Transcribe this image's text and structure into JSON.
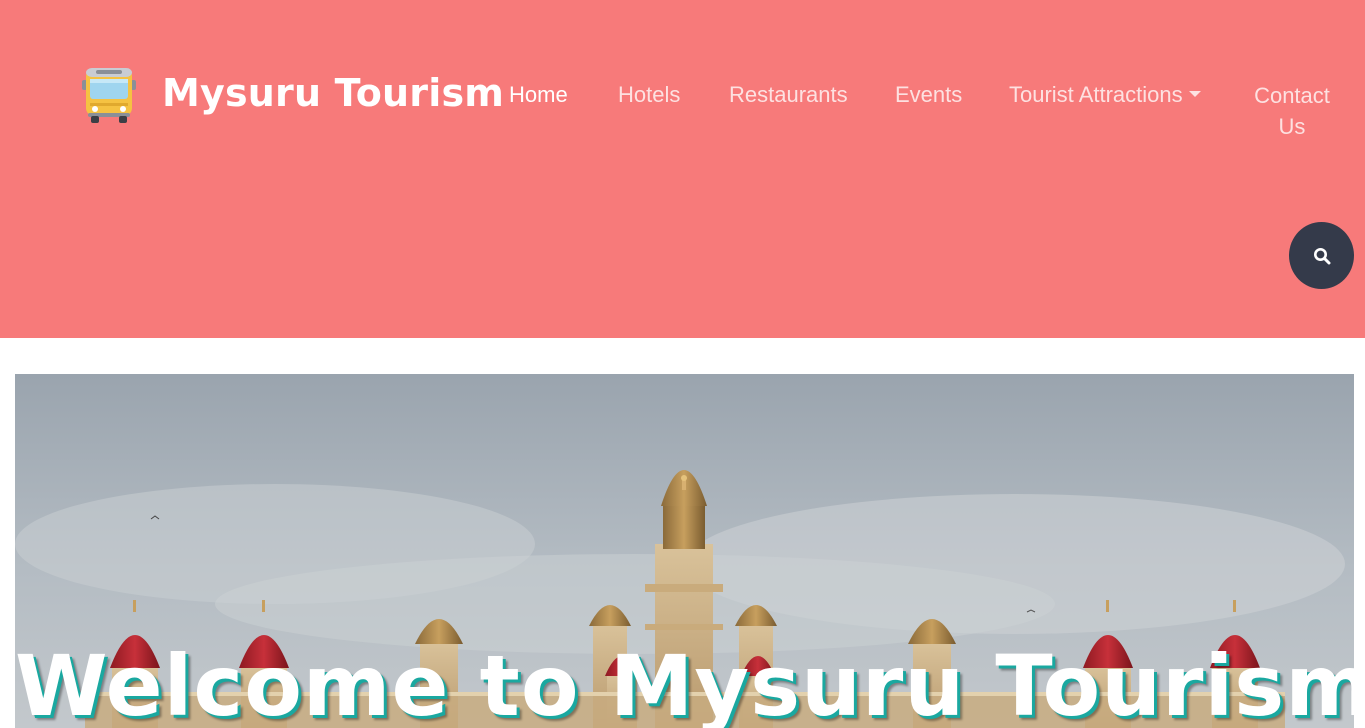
{
  "brand": {
    "name": "Mysuru Tourism",
    "icon": "bus-icon"
  },
  "nav": {
    "items": [
      {
        "label": "Home",
        "active": true
      },
      {
        "label": "Hotels",
        "active": false
      },
      {
        "label": "Restaurants",
        "active": false
      },
      {
        "label": "Events",
        "active": false
      },
      {
        "label": "Tourist Attractions",
        "active": false,
        "dropdown": true
      },
      {
        "label": "Contact Us",
        "active": false
      }
    ]
  },
  "search": {
    "icon": "search-icon"
  },
  "hero": {
    "title": "Welcome to Mysuru Tourism!",
    "image": "mysore-palace-photo"
  },
  "colors": {
    "header_bg": "#f77a7a",
    "search_bg": "#343a4a",
    "title_shadow": "#1aa8a0"
  }
}
